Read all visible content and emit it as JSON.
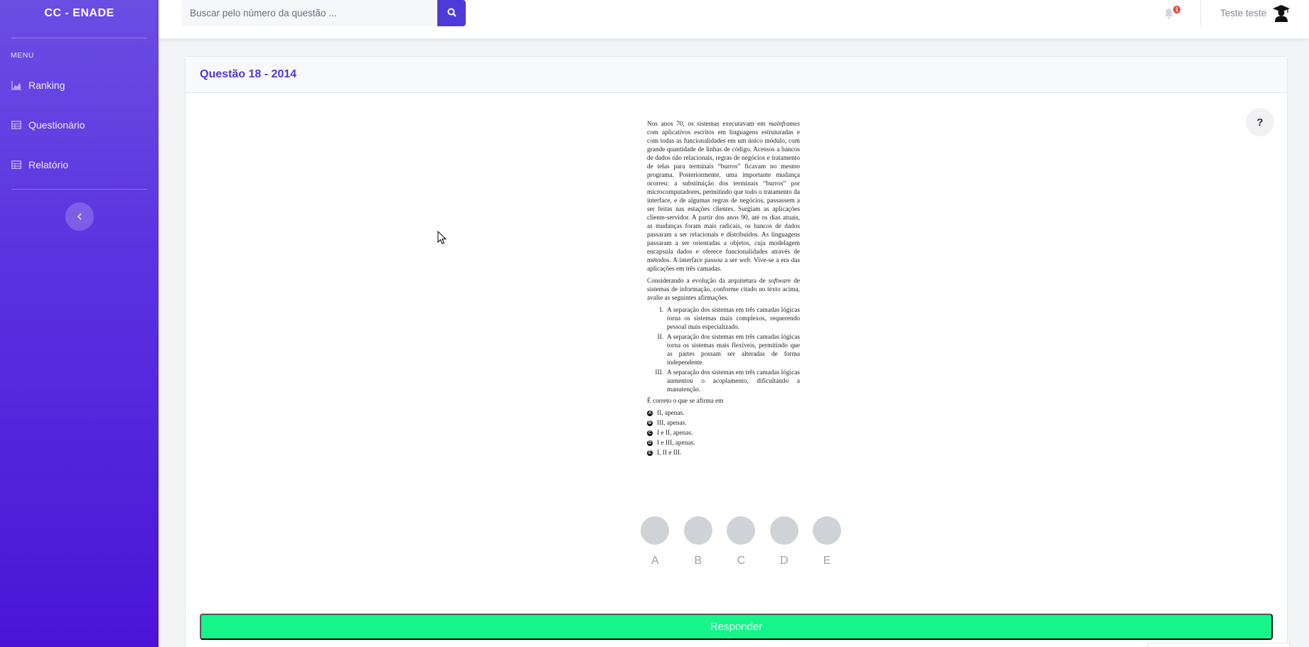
{
  "sidebar": {
    "brand": "CC - ENADE",
    "menu_heading": "MENU",
    "items": [
      {
        "label": "Ranking",
        "icon": "chart-area-icon"
      },
      {
        "label": "Questionário",
        "icon": "table-icon"
      },
      {
        "label": "Relatório",
        "icon": "table-icon"
      }
    ],
    "collapse_icon": "chevron-left-icon"
  },
  "topbar": {
    "search_placeholder": "Buscar pelo número da questão ...",
    "search_icon": "search-icon",
    "notification_count": "1",
    "user_name": "Teste teste",
    "avatar_icon": "graduate-avatar-icon"
  },
  "question": {
    "title": "Questão 18 - 2014",
    "help_label": "?",
    "paragraph1": {
      "parts": [
        "Nos anos 70, os sistemas executavam em ",
        "mainframes",
        " com aplicativos escritos em linguagens estruturadas e com todas as funcionalidades em um único módulo, com grande quantidade de linhas de código. Acessos a bancos de dados não relacionais, regras de negócios e tratamento de telas para terminais “burros” ficavam no mesmo programa. Posteriormente, uma importante mudança ocorreu: a substituição dos terminais “burros” por microcomputadores, permitindo que todo o tratamento da interface, e de algumas regras de negócios, passassem a ser feitas nas estações clientes. Surgiam as aplicações cliente-servidor. A partir dos anos 90, até os dias atuais, as mudanças foram mais radicais, os bancos de dados passaram a ser relacionais e distribuídos. As linguagens passaram a ser orientadas a objetos, cuja modelagem encapsula dados e oferece funcionalidades através de métodos. A interface passou a ser ",
        "web",
        ". Vive-se a era das aplicações em três camadas."
      ]
    },
    "paragraph2": {
      "parts": [
        "Considerando a evolução da arquitetura de ",
        "software",
        " de sistemas de informação, conforme citado no texto acima, avalie as seguintes afirmações."
      ]
    },
    "statements": [
      {
        "numeral": "I.",
        "text": "A separação dos sistemas em três camadas lógicas torna os sistemas mais complexos, requerendo pessoal mais especializado."
      },
      {
        "numeral": "II.",
        "text": "A separação dos sistemas em três camadas lógicas torna os sistemas mais flexíveis, permitindo que as partes possam ser alteradas de forma independente."
      },
      {
        "numeral": "III.",
        "text": "A separação dos sistemas em três camadas lógicas aumentou o acoplamento, dificultando a manutenção."
      }
    ],
    "prompt": "É correto o que se afirma em",
    "options": [
      {
        "letter": "A",
        "text": "II, apenas."
      },
      {
        "letter": "B",
        "text": "III, apenas."
      },
      {
        "letter": "C",
        "text": "I e II, apenas."
      },
      {
        "letter": "D",
        "text": "I e III, apenas."
      },
      {
        "letter": "E",
        "text": "I, II e III."
      }
    ]
  },
  "choices": [
    "A",
    "B",
    "C",
    "D",
    "E"
  ],
  "answer_button": "Responder",
  "colors": {
    "accent": "#4e3ad6",
    "sidebar_top": "#6a4ee3",
    "sidebar_bottom": "#4a14d8",
    "answer_button": "#16f58a",
    "choice_circle": "#cfd3d8",
    "badge": "#e74a3b"
  }
}
